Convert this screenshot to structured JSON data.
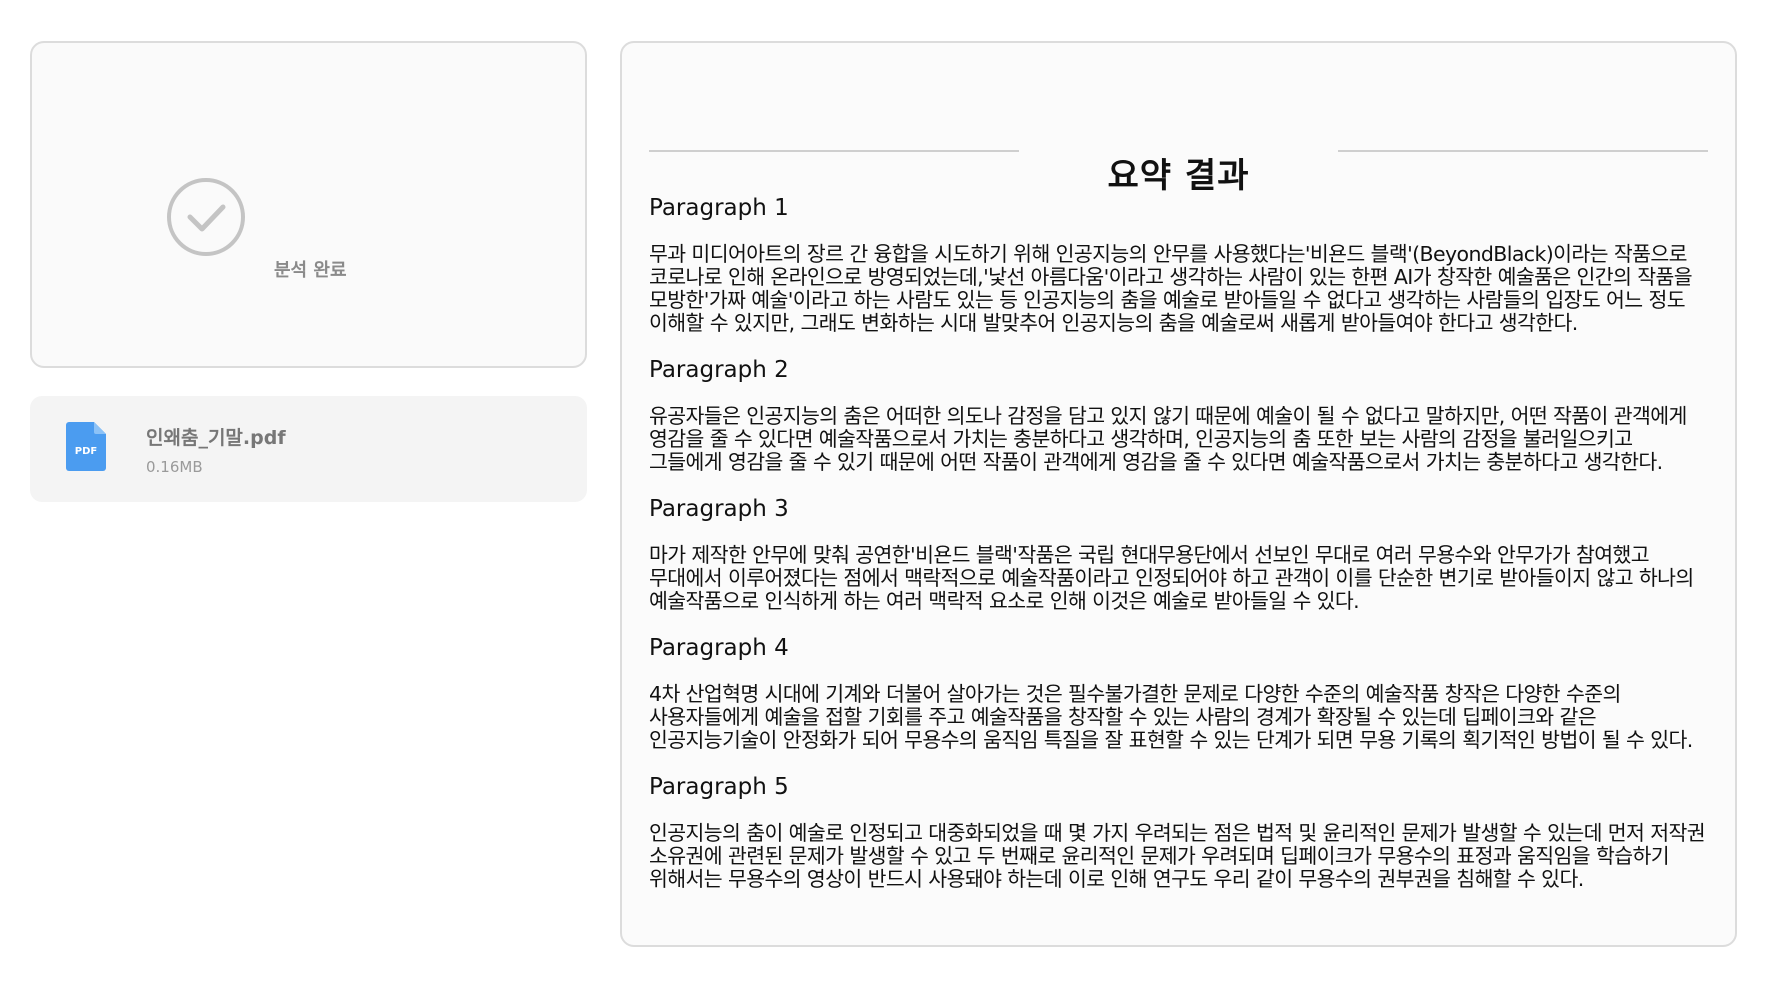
{
  "upload": {
    "status_text": "분석 완료"
  },
  "file": {
    "icon_label": "PDF",
    "name": "인왜춤_기말.pdf",
    "size": "0.16MB",
    "icon_color": "#4b9cf0"
  },
  "summary": {
    "title": "요약 결과",
    "paragraphs": [
      {
        "heading": "Paragraph 1",
        "body": "무과 미디어아트의 장르 간 융합을 시도하기 위해 인공지능의 안무를 사용했다는'비욘드 블랙'(BeyondBlack)이라는 작품으로 코로나로 인해 온라인으로 방영되었는데,'낯선 아름다움'이라고 생각하는 사람이 있는 한편 AI가 창작한 예술품은 인간의 작품을 모방한'가짜 예술'이라고 하는 사람도 있는 등 인공지능의 춤을 예술로 받아들일 수 없다고 생각하는 사람들의 입장도 어느 정도 이해할 수 있지만, 그래도 변화하는 시대 발맞추어 인공지능의 춤을 예술로써 새롭게 받아들여야 한다고 생각한다."
      },
      {
        "heading": "Paragraph 2",
        "body": "유공자들은 인공지능의 춤은 어떠한 의도나 감정을 담고 있지 않기 때문에 예술이 될 수 없다고 말하지만, 어떤 작품이 관객에게 영감을 줄 수 있다면 예술작품으로서 가치는 충분하다고 생각하며, 인공지능의 춤 또한 보는 사람의 감정을 불러일으키고 그들에게 영감을 줄 수 있기 때문에 어떤 작품이 관객에게 영감을 줄 수 있다면 예술작품으로서 가치는 충분하다고 생각한다."
      },
      {
        "heading": "Paragraph 3",
        "body": "마가 제작한 안무에 맞춰 공연한'비욘드 블랙'작품은 국립 현대무용단에서 선보인 무대로 여러 무용수와 안무가가 참여했고 무대에서 이루어졌다는 점에서 맥락적으로 예술작품이라고 인정되어야 하고 관객이 이를 단순한 변기로 받아들이지 않고 하나의 예술작품으로 인식하게 하는 여러 맥락적 요소로 인해 이것은 예술로 받아들일 수 있다."
      },
      {
        "heading": "Paragraph 4",
        "body": "4차 산업혁명 시대에 기계와 더불어 살아가는 것은 필수불가결한 문제로 다양한 수준의 예술작품 창작은 다양한 수준의 사용자들에게 예술을 접할 기회를 주고 예술작품을 창작할 수 있는 사람의 경계가 확장될 수 있는데 딥페이크와 같은 인공지능기술이 안정화가 되어 무용수의 움직임 특질을 잘 표현할 수 있는 단계가 되면 무용 기록의 획기적인 방법이 될 수 있다."
      },
      {
        "heading": "Paragraph 5",
        "body": "인공지능의 춤이 예술로 인정되고 대중화되었을 때 몇 가지 우려되는 점은 법적 및 윤리적인 문제가 발생할 수 있는데 먼저 저작권 소유권에 관련된 문제가 발생할 수 있고 두 번째로 윤리적인 문제가 우려되며 딥페이크가 무용수의 표정과 움직임을 학습하기 위해서는 무용수의 영상이 반드시 사용돼야 하는데 이로 인해 연구도 우리 같이 무용수의 권부권을 침해할 수 있다."
      }
    ]
  }
}
